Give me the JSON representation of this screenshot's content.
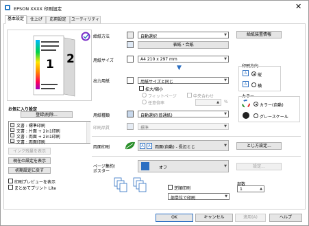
{
  "window": {
    "title": "EPSON XXXX 印刷設定",
    "close": "✕"
  },
  "tabs": [
    "基本設定",
    "仕上げ",
    "応用設定",
    "ユーティリティー"
  ],
  "left": {
    "preview_page_numbers": [
      "1",
      "2"
    ],
    "favorites_title": "お気に入り設定",
    "register_button": "登録/削除...",
    "favorites": [
      "文書 : 標準印刷",
      "文書 : 片面 + 2in1印刷",
      "文書 : 両面 + 2in1印刷",
      "文書 : 両面印刷"
    ],
    "ink_button": "インク残量を表示",
    "show_current_button": "現在の設定を表示",
    "reset_button": "初期設定に戻す",
    "preview_checkbox": "印刷プレビューを表示",
    "lite_checkbox": "まとめてプリント Lite"
  },
  "main": {
    "paper_source": {
      "label": "給紙方法",
      "value": "自動選択"
    },
    "paper_info_button": "給紙装置情報",
    "cover_button": "表紙・合紙",
    "paper_size": {
      "label": "用紙サイズ",
      "value": "A4 210 x 297 mm"
    },
    "output_paper": {
      "label": "出力用紙",
      "value": "用紙サイズと同じ"
    },
    "scale_checkbox": "拡大/縮小",
    "fit_page": "フィットページ",
    "center": "中央合わせ",
    "any_scale": "任意倍率",
    "percent": "%",
    "orientation": {
      "title": "印刷方向",
      "portrait": "縦",
      "landscape": "横"
    },
    "paper_type": {
      "label": "用紙種類",
      "value": "自動選択(普通紙)"
    },
    "quality": {
      "label": "印刷品質",
      "value": "標準"
    },
    "color": {
      "title": "カラー",
      "auto": "カラー(自動)",
      "gray": "グレースケール"
    },
    "duplex": {
      "label": "両面印刷",
      "value": "両面(自動) - 長辺とじ"
    },
    "binding_button": "とじ方設定...",
    "multipage": {
      "label1": "ページ集約/",
      "label2": "ポスター",
      "value": "オフ"
    },
    "settings_button": "設定...",
    "reverse_checkbox": "逆順印刷",
    "collate": {
      "value": "部単位で印刷"
    },
    "copies": {
      "label": "部数",
      "value": "1"
    }
  },
  "footer": {
    "ok": "OK",
    "cancel": "キャンセル",
    "apply": "適用(A)",
    "help": "ヘルプ"
  },
  "colors": {
    "accent": "#2c6fc2",
    "green": "#2a8f2a"
  }
}
